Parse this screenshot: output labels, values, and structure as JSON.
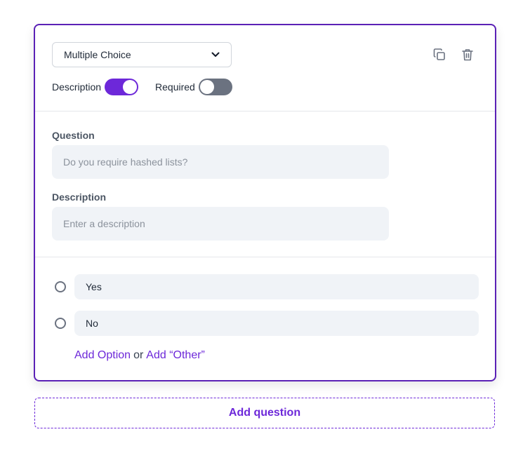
{
  "question_card": {
    "type_select": {
      "value": "Multiple Choice",
      "icon": "chevron-down-icon"
    },
    "actions": {
      "duplicate_icon": "copy-icon",
      "delete_icon": "trash-icon"
    },
    "toggles": {
      "description": {
        "label": "Description",
        "on": true
      },
      "required": {
        "label": "Required",
        "on": false
      }
    },
    "question": {
      "label": "Question",
      "value": "",
      "placeholder": "Do you require hashed lists?"
    },
    "description": {
      "label": "Description",
      "value": "",
      "placeholder": "Enter a description"
    },
    "options": [
      {
        "label": "Yes",
        "selected": false
      },
      {
        "label": "No",
        "selected": false
      }
    ],
    "add_links": {
      "add_option": "Add Option",
      "separator": "or",
      "add_other": "Add “Other”"
    }
  },
  "add_question_label": "Add question",
  "colors": {
    "accent": "#6d28d9",
    "card_border": "#5b21b6",
    "toggle_off": "#6b7280",
    "input_bg": "#f0f3f7"
  }
}
